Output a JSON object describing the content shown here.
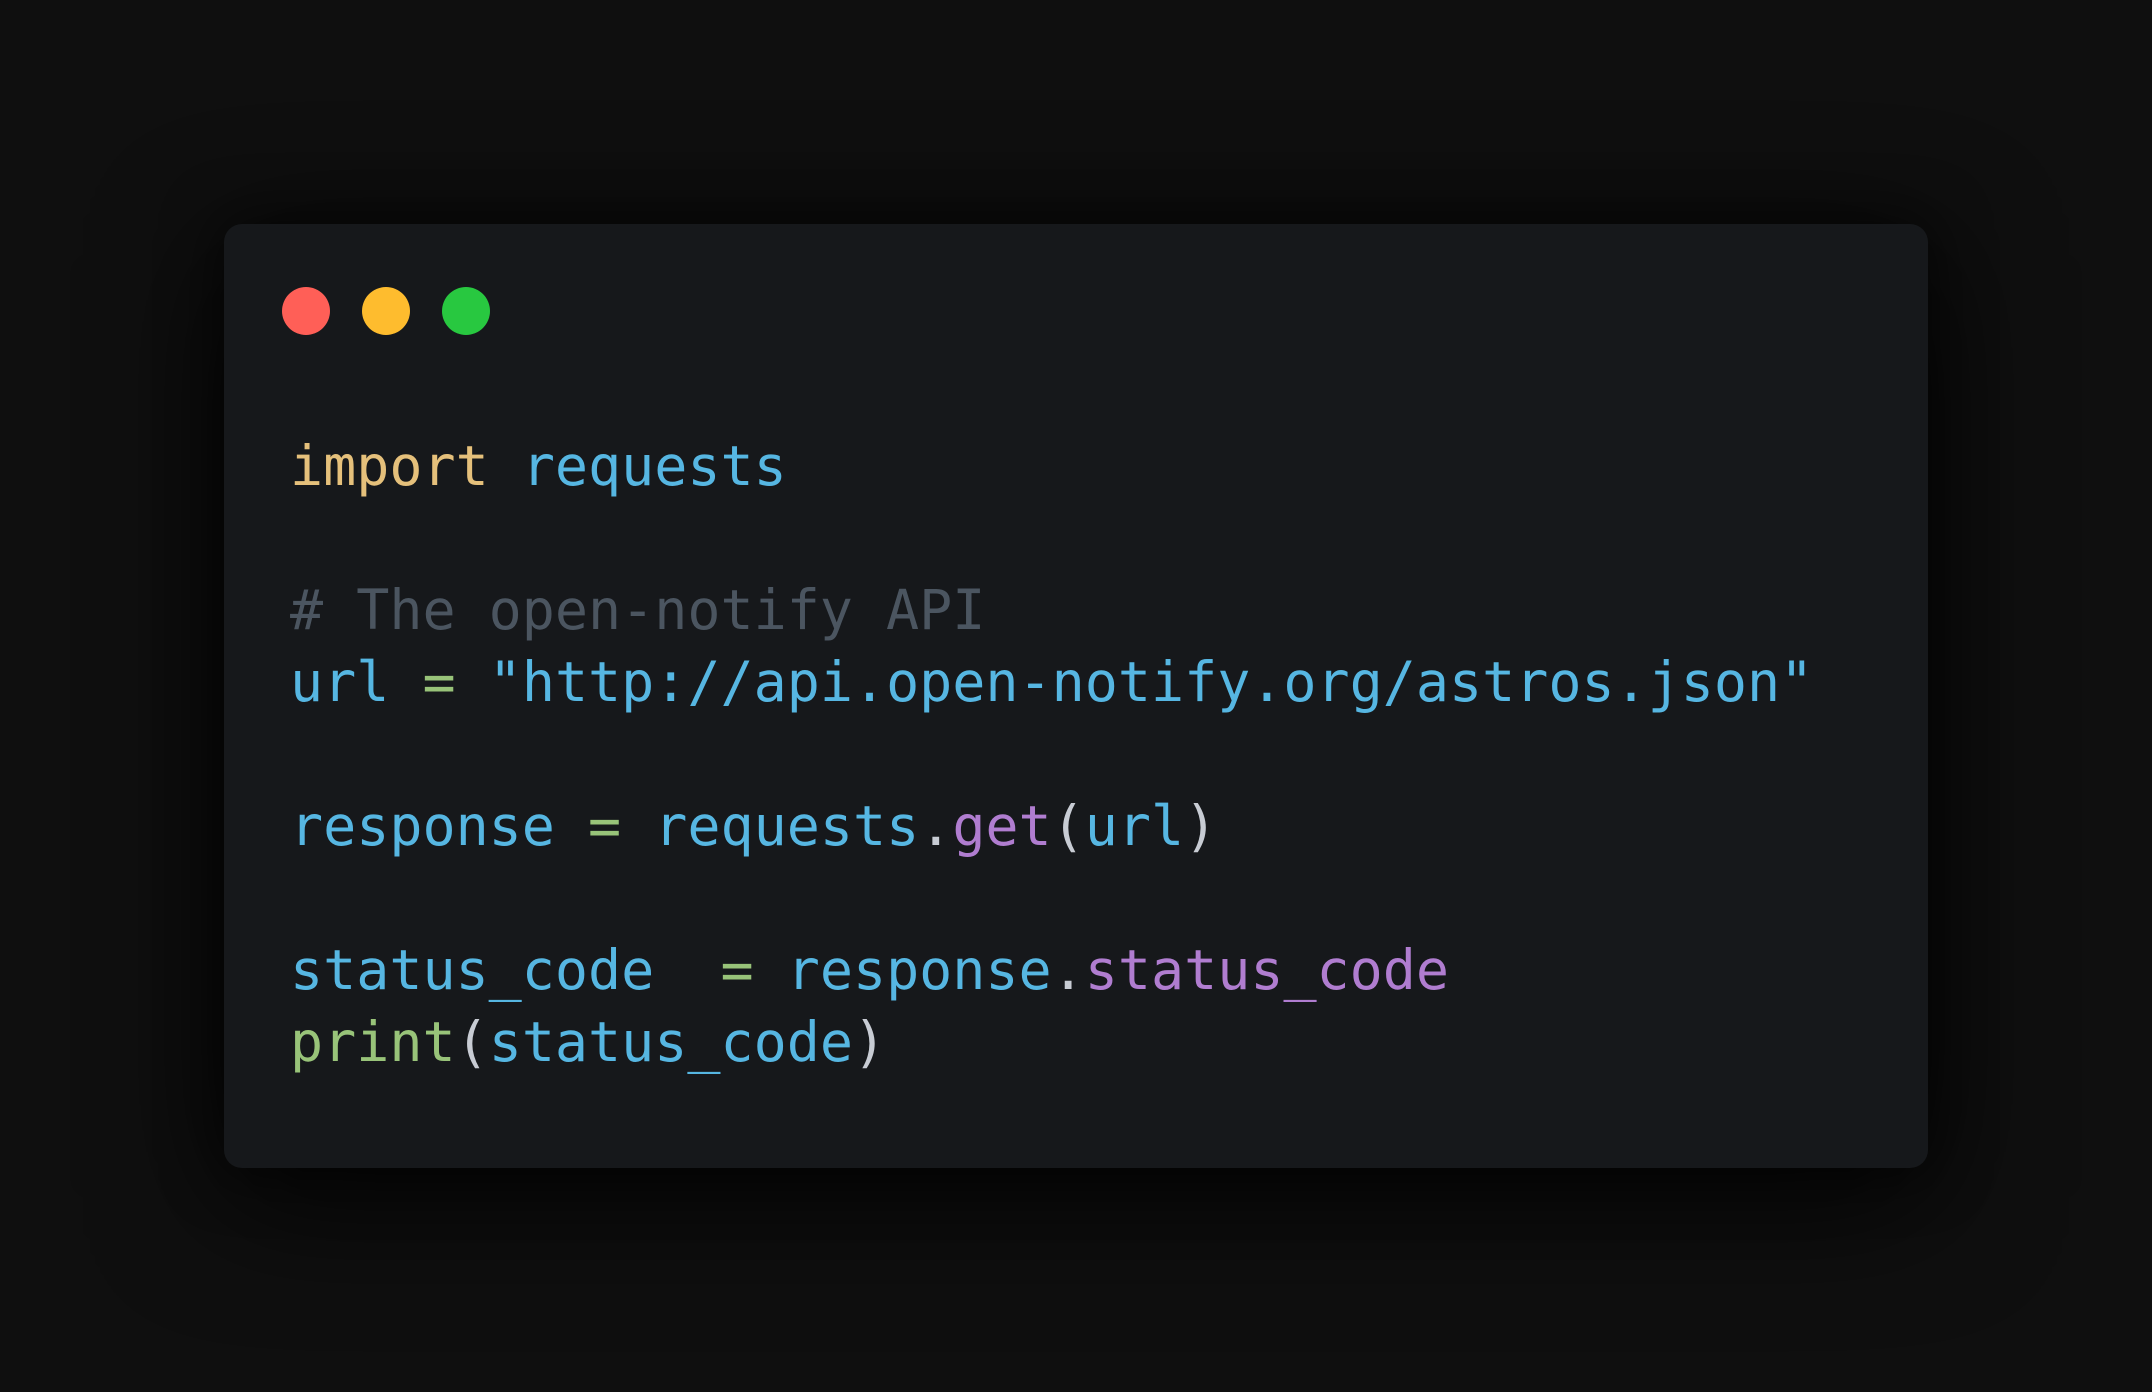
{
  "colors": {
    "background": "#0f0f0f",
    "window_bg": "#16181b",
    "dot_close": "#ff5f57",
    "dot_minimize": "#febc2e",
    "dot_maximize": "#28c840",
    "keyword": "#e5c07b",
    "identifier": "#56b6e2",
    "operator": "#98c379",
    "method": "#b07dd0",
    "builtin": "#98c379",
    "punctuation": "#c8ccd4",
    "comment": "#4b5560",
    "string": "#56b6e2"
  },
  "code": {
    "lines": [
      {
        "tokens": [
          {
            "text": "import",
            "type": "keyword"
          },
          {
            "text": " ",
            "type": "space"
          },
          {
            "text": "requests",
            "type": "identifier"
          }
        ]
      },
      {
        "tokens": []
      },
      {
        "tokens": [
          {
            "text": "# The open-notify API",
            "type": "comment"
          }
        ]
      },
      {
        "tokens": [
          {
            "text": "url",
            "type": "identifier"
          },
          {
            "text": " ",
            "type": "space"
          },
          {
            "text": "=",
            "type": "operator"
          },
          {
            "text": " ",
            "type": "space"
          },
          {
            "text": "\"http://api.open-notify.org/astros.json\"",
            "type": "string"
          }
        ]
      },
      {
        "tokens": []
      },
      {
        "tokens": [
          {
            "text": "response",
            "type": "identifier"
          },
          {
            "text": " ",
            "type": "space"
          },
          {
            "text": "=",
            "type": "operator"
          },
          {
            "text": " ",
            "type": "space"
          },
          {
            "text": "requests",
            "type": "identifier"
          },
          {
            "text": ".",
            "type": "punctuation"
          },
          {
            "text": "get",
            "type": "method"
          },
          {
            "text": "(",
            "type": "punctuation"
          },
          {
            "text": "url",
            "type": "identifier"
          },
          {
            "text": ")",
            "type": "punctuation"
          }
        ]
      },
      {
        "tokens": []
      },
      {
        "tokens": [
          {
            "text": "status_code",
            "type": "identifier"
          },
          {
            "text": "  ",
            "type": "space"
          },
          {
            "text": "=",
            "type": "operator"
          },
          {
            "text": " ",
            "type": "space"
          },
          {
            "text": "response",
            "type": "identifier"
          },
          {
            "text": ".",
            "type": "punctuation"
          },
          {
            "text": "status_code",
            "type": "method"
          }
        ]
      },
      {
        "tokens": [
          {
            "text": "print",
            "type": "builtin"
          },
          {
            "text": "(",
            "type": "punctuation"
          },
          {
            "text": "status_code",
            "type": "identifier"
          },
          {
            "text": ")",
            "type": "punctuation"
          }
        ]
      }
    ]
  }
}
